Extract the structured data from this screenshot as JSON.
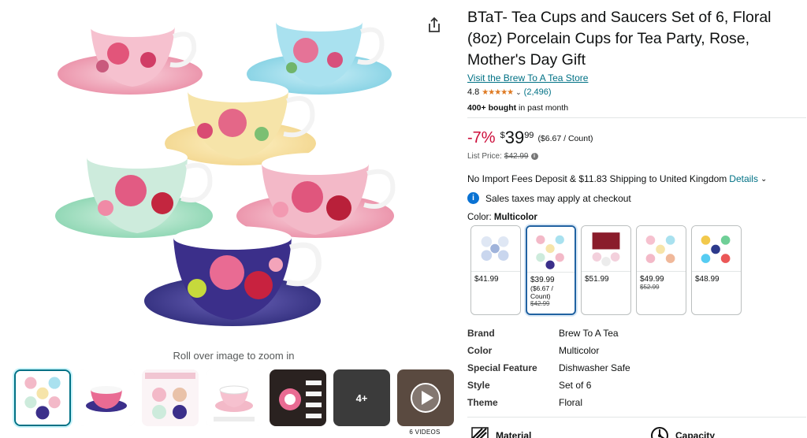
{
  "colors": {
    "link": "#007185",
    "discount": "#cc0c39",
    "star": "#de7921",
    "selected_border": "#2162a1",
    "thumb_selected": "#007185"
  },
  "gallery": {
    "zoom_hint": "Roll over image to zoom in",
    "thumbnails": [
      {
        "icon": "teacup-set-thumb"
      },
      {
        "icon": "single-teacup-thumb"
      },
      {
        "icon": "infographic-thumb"
      },
      {
        "icon": "teacup-gift-thumb"
      },
      {
        "icon": "dark-infographic-thumb"
      },
      {
        "more_label": "4+"
      },
      {
        "icon": "video-play-thumb"
      }
    ],
    "videos_label": "6 VIDEOS",
    "share_icon": "share-icon"
  },
  "product": {
    "title": "BTaT- Tea Cups and Saucers Set of 6, Floral (8oz) Porcelain Cups for Tea Party, Rose, Mother's Day Gift",
    "store_link": "Visit the Brew To A Tea Store",
    "rating": "4.8",
    "stars": "★★★★★",
    "rating_count": "(2,496)",
    "bought_bold": "400+ bought",
    "bought_rest": " in past month"
  },
  "price": {
    "discount": "-7%",
    "symbol": "$",
    "whole": "39",
    "fraction": "99",
    "unit_price": "($6.67 / Count)",
    "list_label": "List Price:",
    "list_value": "$42.99"
  },
  "shipping": {
    "text": "No Import Fees Deposit & $11.83 Shipping to United Kingdom",
    "details": "Details"
  },
  "tax": {
    "text": "Sales taxes may apply at checkout"
  },
  "color": {
    "label": "Color:",
    "value": "Multicolor",
    "swatches": [
      {
        "price": "$41.99",
        "unit": "",
        "list": "",
        "selected": false
      },
      {
        "price": "$39.99",
        "unit": "($6.67 / Count)",
        "list": "$42.99",
        "selected": true
      },
      {
        "price": "$51.99",
        "unit": "",
        "list": "",
        "selected": false
      },
      {
        "price": "$49.99",
        "unit": "",
        "list": "$52.99",
        "selected": false
      },
      {
        "price": "$48.99",
        "unit": "",
        "list": "",
        "selected": false
      }
    ]
  },
  "specs": [
    {
      "key": "Brand",
      "value": "Brew To A Tea"
    },
    {
      "key": "Color",
      "value": "Multicolor"
    },
    {
      "key": "Special Feature",
      "value": "Dishwasher Safe"
    },
    {
      "key": "Style",
      "value": "Set of 6"
    },
    {
      "key": "Theme",
      "value": "Floral"
    }
  ],
  "bottom_features": [
    {
      "label": "Material",
      "icon": "material-icon"
    },
    {
      "label": "Capacity",
      "icon": "capacity-icon"
    }
  ]
}
